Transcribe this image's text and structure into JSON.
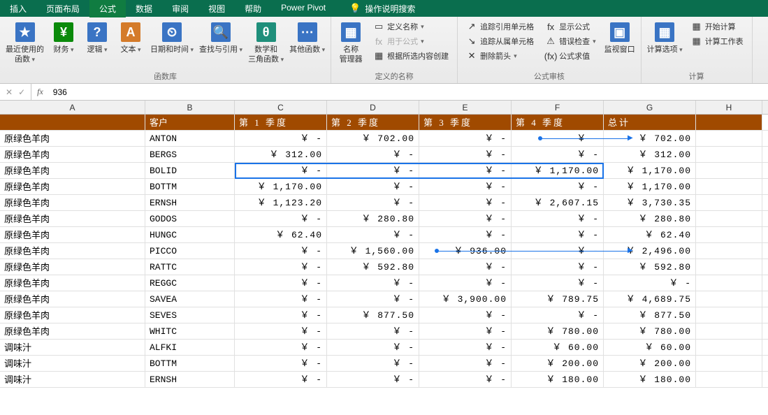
{
  "tabs": {
    "items": [
      "插入",
      "页面布局",
      "公式",
      "数据",
      "审阅",
      "视图",
      "帮助",
      "Power Pivot"
    ],
    "active_index": 2,
    "search_prompt": "操作说明搜索"
  },
  "ribbon": {
    "groups": [
      {
        "label": "函数库",
        "buttons": [
          {
            "name": "recent-func",
            "label": "最近使用的\n函数",
            "icon": "★",
            "color": "blue2",
            "dd": true
          },
          {
            "name": "financial",
            "label": "财务",
            "icon": "¥",
            "color": "green",
            "dd": true
          },
          {
            "name": "logical",
            "label": "逻辑",
            "icon": "?",
            "color": "blue2",
            "dd": true
          },
          {
            "name": "text",
            "label": "文本",
            "icon": "A",
            "color": "orange",
            "dd": true
          },
          {
            "name": "datetime",
            "label": "日期和时间",
            "icon": "⏲",
            "color": "blue2",
            "dd": true
          },
          {
            "name": "lookup",
            "label": "查找与引用",
            "icon": "🔍",
            "color": "blue2",
            "dd": true
          },
          {
            "name": "math",
            "label": "数学和\n三角函数",
            "icon": "θ",
            "color": "teal",
            "dd": true
          },
          {
            "name": "more",
            "label": "其他函数",
            "icon": "⋯",
            "color": "blue2",
            "dd": true
          }
        ]
      },
      {
        "label": "定义的名称",
        "leading": {
          "name": "name-manager",
          "label": "名称\n管理器",
          "icon": "▦"
        },
        "items": [
          {
            "name": "define-name",
            "label": "定义名称",
            "icon": "▭",
            "dd": true
          },
          {
            "name": "use-in-formula",
            "label": "用于公式",
            "icon": "fx",
            "dd": true,
            "disabled": true
          },
          {
            "name": "create-from-sel",
            "label": "根据所选内容创建",
            "icon": "▦"
          }
        ]
      },
      {
        "label": "公式审核",
        "cols": [
          [
            {
              "name": "trace-precedents",
              "label": "追踪引用单元格",
              "icon": "↗"
            },
            {
              "name": "trace-dependents",
              "label": "追踪从属单元格",
              "icon": "↘"
            },
            {
              "name": "remove-arrows",
              "label": "删除箭头",
              "icon": "✕",
              "dd": true
            }
          ],
          [
            {
              "name": "show-formulas",
              "label": "显示公式",
              "icon": "fx"
            },
            {
              "name": "error-check",
              "label": "错误检查",
              "icon": "⚠",
              "dd": true
            },
            {
              "name": "evaluate",
              "label": "公式求值",
              "icon": "(fx)"
            }
          ]
        ],
        "trailing": {
          "name": "watch-window",
          "label": "监视窗口",
          "icon": "▣"
        }
      },
      {
        "label": "计算",
        "leading": {
          "name": "calc-options",
          "label": "计算选项",
          "icon": "▦",
          "dd": true
        },
        "items": [
          {
            "name": "calc-now",
            "label": "开始计算",
            "icon": "▦"
          },
          {
            "name": "calc-sheet",
            "label": "计算工作表",
            "icon": "▦"
          }
        ]
      }
    ]
  },
  "formula_bar": {
    "cancel": "✕",
    "accept": "✓",
    "fx": "fx",
    "value": "936"
  },
  "grid": {
    "col_letters": [
      "A",
      "B",
      "C",
      "D",
      "E",
      "F",
      "G",
      "H"
    ],
    "header": [
      "",
      "客户",
      "第 1 季度",
      "第 2 季度",
      "第 3 季度",
      "第 4 季度",
      "总计",
      ""
    ],
    "rows": [
      {
        "a": "原绿色羊肉",
        "b": "ANTON",
        "c": "￥      -",
        "d": "￥  702.00",
        "e": "￥      -",
        "f": "￥      -",
        "g": "￥  702.00"
      },
      {
        "a": "原绿色羊肉",
        "b": "BERGS",
        "c": "￥  312.00",
        "d": "￥      -",
        "e": "￥      -",
        "f": "￥      -",
        "g": "￥  312.00"
      },
      {
        "a": "原绿色羊肉",
        "b": "BOLID",
        "c": "￥      -",
        "d": "￥      -",
        "e": "￥      -",
        "f": "￥ 1,170.00",
        "g": "￥ 1,170.00"
      },
      {
        "a": "原绿色羊肉",
        "b": "BOTTM",
        "c": "￥ 1,170.00",
        "d": "￥      -",
        "e": "￥      -",
        "f": "￥      -",
        "g": "￥ 1,170.00"
      },
      {
        "a": "原绿色羊肉",
        "b": "ERNSH",
        "c": "￥ 1,123.20",
        "d": "￥      -",
        "e": "￥      -",
        "f": "￥ 2,607.15",
        "g": "￥ 3,730.35"
      },
      {
        "a": "原绿色羊肉",
        "b": "GODOS",
        "c": "￥      -",
        "d": "￥  280.80",
        "e": "￥      -",
        "f": "￥      -",
        "g": "￥  280.80"
      },
      {
        "a": "原绿色羊肉",
        "b": "HUNGC",
        "c": "￥   62.40",
        "d": "￥      -",
        "e": "￥      -",
        "f": "￥      -",
        "g": "￥   62.40"
      },
      {
        "a": "原绿色羊肉",
        "b": "PICCO",
        "c": "￥      -",
        "d": "￥ 1,560.00",
        "e": "￥  936.00",
        "f": "￥      -",
        "g": "￥ 2,496.00"
      },
      {
        "a": "原绿色羊肉",
        "b": "RATTC",
        "c": "￥      -",
        "d": "￥  592.80",
        "e": "￥      -",
        "f": "￥      -",
        "g": "￥  592.80"
      },
      {
        "a": "原绿色羊肉",
        "b": "REGGC",
        "c": "￥      -",
        "d": "￥      -",
        "e": "￥      -",
        "f": "￥      -",
        "g": "￥      -"
      },
      {
        "a": "原绿色羊肉",
        "b": "SAVEA",
        "c": "￥      -",
        "d": "￥      -",
        "e": "￥ 3,900.00",
        "f": "￥  789.75",
        "g": "￥ 4,689.75"
      },
      {
        "a": "原绿色羊肉",
        "b": "SEVES",
        "c": "￥      -",
        "d": "￥  877.50",
        "e": "￥      -",
        "f": "￥      -",
        "g": "￥  877.50"
      },
      {
        "a": "原绿色羊肉",
        "b": "WHITC",
        "c": "￥      -",
        "d": "￥      -",
        "e": "￥      -",
        "f": "￥  780.00",
        "g": "￥  780.00"
      },
      {
        "a": "调味汁",
        "b": "ALFKI",
        "c": "￥      -",
        "d": "￥      -",
        "e": "￥      -",
        "f": "￥   60.00",
        "g": "￥   60.00"
      },
      {
        "a": "调味汁",
        "b": "BOTTM",
        "c": "￥      -",
        "d": "￥      -",
        "e": "￥      -",
        "f": "￥  200.00",
        "g": "￥  200.00"
      },
      {
        "a": "调味汁",
        "b": "ERNSH",
        "c": "￥      -",
        "d": "￥      -",
        "e": "￥      -",
        "f": "￥  180.00",
        "g": "￥  180.00"
      }
    ]
  }
}
